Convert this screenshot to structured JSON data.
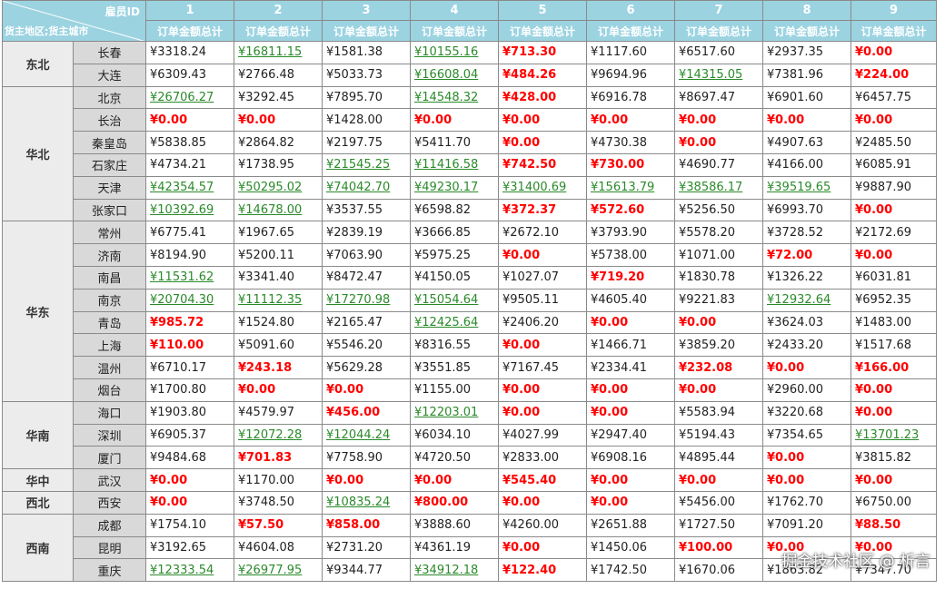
{
  "header": {
    "corner_top": "雇员ID",
    "corner_bottom": "货主地区;货主城市",
    "employee_ids": [
      "1",
      "2",
      "3",
      "4",
      "5",
      "6",
      "7",
      "8",
      "9"
    ],
    "metric_label": "订单金额总计"
  },
  "regions": [
    {
      "name": "东北",
      "cities": [
        {
          "name": "长春",
          "values": [
            "¥3318.24",
            "¥16811.15",
            "¥1581.38",
            "¥10155.16",
            "¥713.30",
            "¥1117.60",
            "¥6517.60",
            "¥2937.35",
            "¥0.00"
          ],
          "styles": [
            "n",
            "g",
            "n",
            "g",
            "r",
            "n",
            "n",
            "n",
            "r"
          ]
        },
        {
          "name": "大连",
          "values": [
            "¥6309.43",
            "¥2766.48",
            "¥5033.73",
            "¥16608.04",
            "¥484.26",
            "¥9694.96",
            "¥14315.05",
            "¥7381.96",
            "¥224.00"
          ],
          "styles": [
            "n",
            "n",
            "n",
            "g",
            "r",
            "n",
            "g",
            "n",
            "r"
          ]
        }
      ]
    },
    {
      "name": "华北",
      "cities": [
        {
          "name": "北京",
          "values": [
            "¥26706.27",
            "¥3292.45",
            "¥7895.70",
            "¥14548.32",
            "¥428.00",
            "¥6916.78",
            "¥8697.47",
            "¥6901.60",
            "¥6457.75"
          ],
          "styles": [
            "g",
            "n",
            "n",
            "g",
            "r",
            "n",
            "n",
            "n",
            "n"
          ]
        },
        {
          "name": "长治",
          "values": [
            "¥0.00",
            "¥0.00",
            "¥1428.00",
            "¥0.00",
            "¥0.00",
            "¥0.00",
            "¥0.00",
            "¥0.00",
            "¥0.00"
          ],
          "styles": [
            "r",
            "r",
            "n",
            "r",
            "r",
            "r",
            "r",
            "r",
            "r"
          ]
        },
        {
          "name": "秦皇岛",
          "values": [
            "¥5838.85",
            "¥2864.82",
            "¥2197.75",
            "¥5411.70",
            "¥0.00",
            "¥4730.38",
            "¥0.00",
            "¥4907.63",
            "¥2485.50"
          ],
          "styles": [
            "n",
            "n",
            "n",
            "n",
            "r",
            "n",
            "r",
            "n",
            "n"
          ]
        },
        {
          "name": "石家庄",
          "values": [
            "¥4734.21",
            "¥1738.95",
            "¥21545.25",
            "¥11416.58",
            "¥742.50",
            "¥730.00",
            "¥4690.77",
            "¥4166.00",
            "¥6085.91"
          ],
          "styles": [
            "n",
            "n",
            "g",
            "g",
            "r",
            "r",
            "n",
            "n",
            "n"
          ]
        },
        {
          "name": "天津",
          "values": [
            "¥42354.57",
            "¥50295.02",
            "¥74042.70",
            "¥49230.17",
            "¥31400.69",
            "¥15613.79",
            "¥38586.17",
            "¥39519.65",
            "¥9887.90"
          ],
          "styles": [
            "g",
            "g",
            "g",
            "g",
            "g",
            "g",
            "g",
            "g",
            "n"
          ]
        },
        {
          "name": "张家口",
          "values": [
            "¥10392.69",
            "¥14678.00",
            "¥3537.55",
            "¥6598.82",
            "¥372.37",
            "¥572.60",
            "¥5256.50",
            "¥6993.70",
            "¥0.00"
          ],
          "styles": [
            "g",
            "g",
            "n",
            "n",
            "r",
            "r",
            "n",
            "n",
            "r"
          ]
        }
      ]
    },
    {
      "name": "华东",
      "cities": [
        {
          "name": "常州",
          "values": [
            "¥6775.41",
            "¥1967.65",
            "¥2839.19",
            "¥3666.85",
            "¥2672.10",
            "¥3793.90",
            "¥5578.20",
            "¥3728.52",
            "¥2172.69"
          ],
          "styles": [
            "n",
            "n",
            "n",
            "n",
            "n",
            "n",
            "n",
            "n",
            "n"
          ]
        },
        {
          "name": "济南",
          "values": [
            "¥8194.90",
            "¥5200.11",
            "¥7063.90",
            "¥5975.25",
            "¥0.00",
            "¥5738.00",
            "¥1071.00",
            "¥72.00",
            "¥0.00"
          ],
          "styles": [
            "n",
            "n",
            "n",
            "n",
            "r",
            "n",
            "n",
            "r",
            "r"
          ]
        },
        {
          "name": "南昌",
          "values": [
            "¥11531.62",
            "¥3341.40",
            "¥8472.47",
            "¥4150.05",
            "¥1027.07",
            "¥719.20",
            "¥1830.78",
            "¥1326.22",
            "¥6031.81"
          ],
          "styles": [
            "g",
            "n",
            "n",
            "n",
            "n",
            "r",
            "n",
            "n",
            "n"
          ]
        },
        {
          "name": "南京",
          "values": [
            "¥20704.30",
            "¥11112.35",
            "¥17270.98",
            "¥15054.64",
            "¥9505.11",
            "¥4605.40",
            "¥9221.83",
            "¥12932.64",
            "¥6952.35"
          ],
          "styles": [
            "g",
            "g",
            "g",
            "g",
            "n",
            "n",
            "n",
            "g",
            "n"
          ]
        },
        {
          "name": "青岛",
          "values": [
            "¥985.72",
            "¥1524.80",
            "¥2165.47",
            "¥12425.64",
            "¥2406.20",
            "¥0.00",
            "¥0.00",
            "¥3624.03",
            "¥1483.00"
          ],
          "styles": [
            "r",
            "n",
            "n",
            "g",
            "n",
            "r",
            "r",
            "n",
            "n"
          ]
        },
        {
          "name": "上海",
          "values": [
            "¥110.00",
            "¥5091.60",
            "¥5546.20",
            "¥8316.55",
            "¥0.00",
            "¥1466.71",
            "¥3859.20",
            "¥2433.20",
            "¥1517.68"
          ],
          "styles": [
            "r",
            "n",
            "n",
            "n",
            "r",
            "n",
            "n",
            "n",
            "n"
          ]
        },
        {
          "name": "温州",
          "values": [
            "¥6710.17",
            "¥243.18",
            "¥5629.28",
            "¥3551.85",
            "¥7167.45",
            "¥2334.41",
            "¥232.08",
            "¥0.00",
            "¥166.00"
          ],
          "styles": [
            "n",
            "r",
            "n",
            "n",
            "n",
            "n",
            "r",
            "r",
            "r"
          ]
        },
        {
          "name": "烟台",
          "values": [
            "¥1700.80",
            "¥0.00",
            "¥0.00",
            "¥1155.00",
            "¥0.00",
            "¥0.00",
            "¥0.00",
            "¥2960.00",
            "¥0.00"
          ],
          "styles": [
            "n",
            "r",
            "r",
            "n",
            "r",
            "r",
            "r",
            "n",
            "r"
          ]
        }
      ]
    },
    {
      "name": "华南",
      "cities": [
        {
          "name": "海口",
          "values": [
            "¥1903.80",
            "¥4579.97",
            "¥456.00",
            "¥12203.01",
            "¥0.00",
            "¥0.00",
            "¥5583.94",
            "¥3220.68",
            "¥0.00"
          ],
          "styles": [
            "n",
            "n",
            "r",
            "g",
            "r",
            "r",
            "n",
            "n",
            "r"
          ]
        },
        {
          "name": "深圳",
          "values": [
            "¥6905.37",
            "¥12072.28",
            "¥12044.24",
            "¥6034.10",
            "¥4027.99",
            "¥2947.40",
            "¥5194.43",
            "¥7354.65",
            "¥13701.23"
          ],
          "styles": [
            "n",
            "g",
            "g",
            "n",
            "n",
            "n",
            "n",
            "n",
            "g"
          ]
        },
        {
          "name": "厦门",
          "values": [
            "¥9484.68",
            "¥701.83",
            "¥7758.90",
            "¥4720.50",
            "¥2833.00",
            "¥6908.16",
            "¥4895.44",
            "¥0.00",
            "¥3815.82"
          ],
          "styles": [
            "n",
            "r",
            "n",
            "n",
            "n",
            "n",
            "n",
            "r",
            "n"
          ]
        }
      ]
    },
    {
      "name": "华中",
      "cities": [
        {
          "name": "武汉",
          "values": [
            "¥0.00",
            "¥1170.00",
            "¥0.00",
            "¥0.00",
            "¥545.40",
            "¥0.00",
            "¥0.00",
            "¥0.00",
            "¥0.00"
          ],
          "styles": [
            "r",
            "n",
            "r",
            "r",
            "r",
            "r",
            "r",
            "r",
            "r"
          ]
        }
      ]
    },
    {
      "name": "西北",
      "cities": [
        {
          "name": "西安",
          "values": [
            "¥0.00",
            "¥3748.50",
            "¥10835.24",
            "¥800.00",
            "¥0.00",
            "¥0.00",
            "¥5456.00",
            "¥1762.70",
            "¥6750.00"
          ],
          "styles": [
            "r",
            "n",
            "g",
            "r",
            "r",
            "r",
            "n",
            "n",
            "n"
          ]
        }
      ]
    },
    {
      "name": "西南",
      "cities": [
        {
          "name": "成都",
          "values": [
            "¥1754.10",
            "¥57.50",
            "¥858.00",
            "¥3888.60",
            "¥4260.00",
            "¥2651.88",
            "¥1727.50",
            "¥7091.20",
            "¥88.50"
          ],
          "styles": [
            "n",
            "r",
            "r",
            "n",
            "n",
            "n",
            "n",
            "n",
            "r"
          ]
        },
        {
          "name": "昆明",
          "values": [
            "¥3192.65",
            "¥4604.08",
            "¥2731.20",
            "¥4361.19",
            "¥0.00",
            "¥1450.06",
            "¥100.00",
            "¥0.00",
            "¥0.00"
          ],
          "styles": [
            "n",
            "n",
            "n",
            "n",
            "r",
            "n",
            "r",
            "r",
            "r"
          ]
        },
        {
          "name": "重庆",
          "values": [
            "¥12333.54",
            "¥26977.95",
            "¥9344.77",
            "¥34912.18",
            "¥122.40",
            "¥1742.50",
            "¥1670.06",
            "¥1863.82",
            "¥7347.70"
          ],
          "styles": [
            "g",
            "g",
            "n",
            "g",
            "r",
            "n",
            "n",
            "n",
            "n"
          ]
        }
      ]
    }
  ],
  "colors": {
    "header_bg": "#9bd3e1",
    "red": "#ff0000",
    "green": "#2a8a2a"
  },
  "watermark": "掘金技术社区 @ 析言"
}
